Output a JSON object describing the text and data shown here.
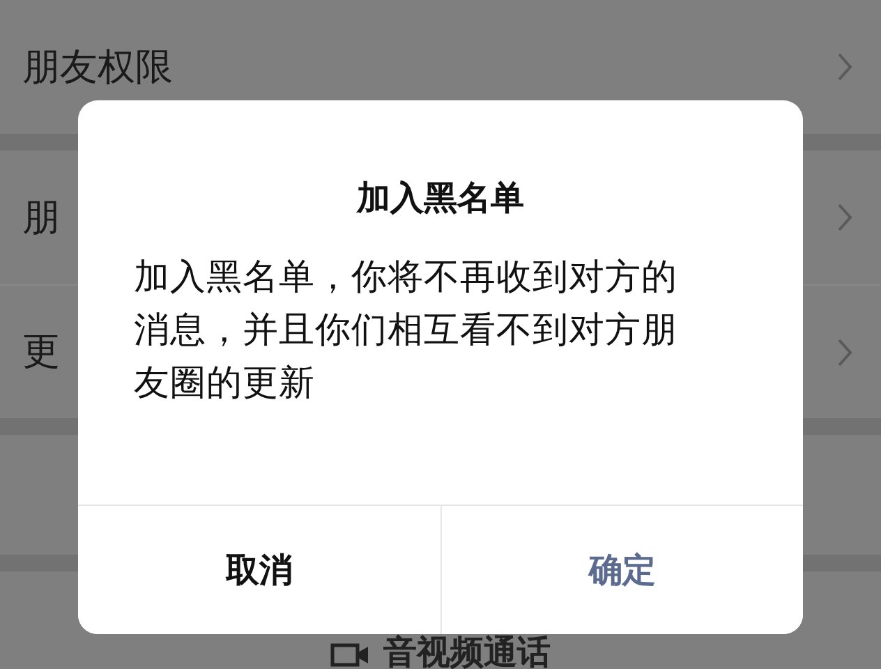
{
  "background_sections": [
    {
      "kind": "list",
      "rows": [
        {
          "label": "朋友权限"
        }
      ]
    },
    {
      "kind": "list",
      "rows": [
        {
          "label": "朋"
        },
        {
          "label": "更"
        }
      ]
    },
    {
      "kind": "blank"
    },
    {
      "kind": "call",
      "label": "音视频通话"
    }
  ],
  "dialog": {
    "title": "加入黑名单",
    "message": "加入黑名单，你将不再收到对方的消息，并且你们相互看不到对方朋友圈的更新",
    "buttons": [
      {
        "label": "取消",
        "kind": "cancel"
      },
      {
        "label": "确定",
        "kind": "confirm"
      }
    ]
  }
}
